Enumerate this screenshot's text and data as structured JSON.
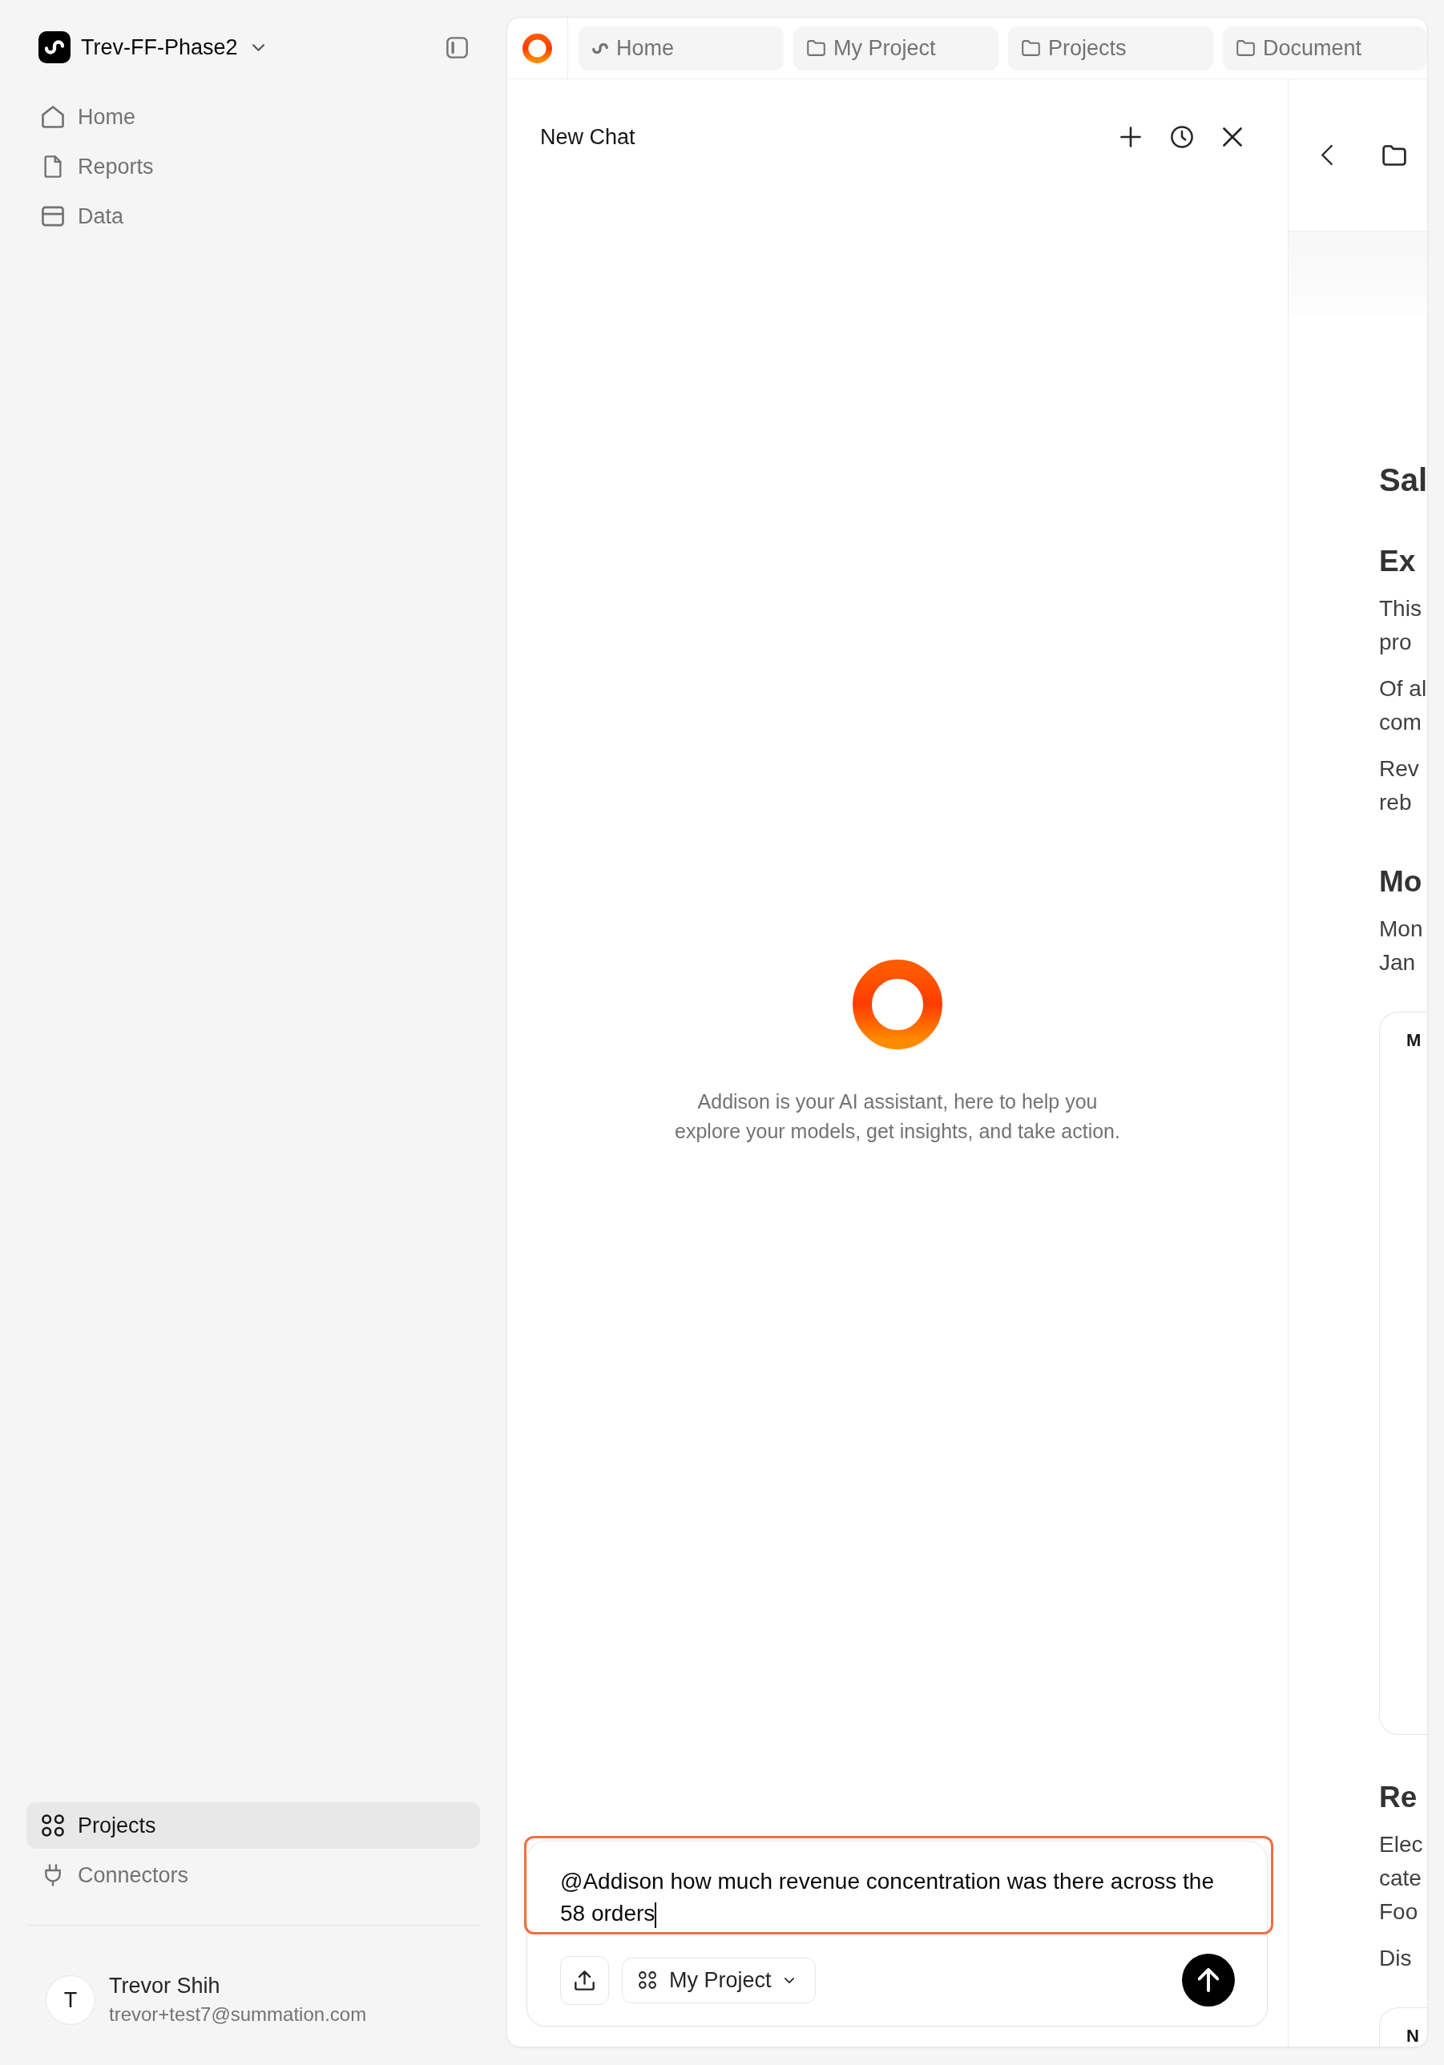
{
  "sidebar": {
    "workspace": {
      "name": "Trev-FF-Phase2"
    },
    "nav_items": [
      {
        "label": "Home",
        "selected": false
      },
      {
        "label": "Reports",
        "selected": false
      },
      {
        "label": "Data",
        "selected": false
      }
    ],
    "bottom_items": [
      {
        "label": "Projects",
        "selected": true
      },
      {
        "label": "Connectors",
        "selected": false
      }
    ],
    "user": {
      "initial": "T",
      "name": "Trevor Shih",
      "email": "trevor+test7@summation.com"
    }
  },
  "tabs": [
    {
      "label": "Home",
      "kind": "workspace"
    },
    {
      "label": "My Project",
      "kind": "folder"
    },
    {
      "label": "Projects",
      "kind": "folder"
    },
    {
      "label": "Document",
      "kind": "folder"
    }
  ],
  "chat": {
    "title": "New Chat",
    "intro_lines": [
      "Addison is your AI assistant, here to help you",
      "explore your models, get insights, and take action."
    ],
    "composer": {
      "value": "@Addison how much revenue concentration was there across the 58 orders",
      "focused": true,
      "project": "My Project"
    }
  },
  "document": {
    "blocks": [
      {
        "kind": "title",
        "text": "Sal"
      },
      {
        "kind": "heading",
        "text": "Ex"
      },
      {
        "kind": "paragraph",
        "lines": [
          "This",
          "pro"
        ]
      },
      {
        "kind": "paragraph",
        "lines": [
          "Of al",
          "com"
        ]
      },
      {
        "kind": "paragraph",
        "lines": [
          "Rev",
          "reb"
        ]
      },
      {
        "kind": "heading",
        "text": "Mo"
      },
      {
        "kind": "paragraph",
        "lines": [
          "Mon",
          "Jan"
        ]
      },
      {
        "kind": "card",
        "title": "M"
      },
      {
        "kind": "heading",
        "text": "Re"
      },
      {
        "kind": "paragraph",
        "lines": [
          "Elec",
          "cate",
          "Foo"
        ]
      },
      {
        "kind": "paragraph",
        "lines": [
          "Dis"
        ]
      },
      {
        "kind": "card",
        "title": "N"
      }
    ]
  }
}
